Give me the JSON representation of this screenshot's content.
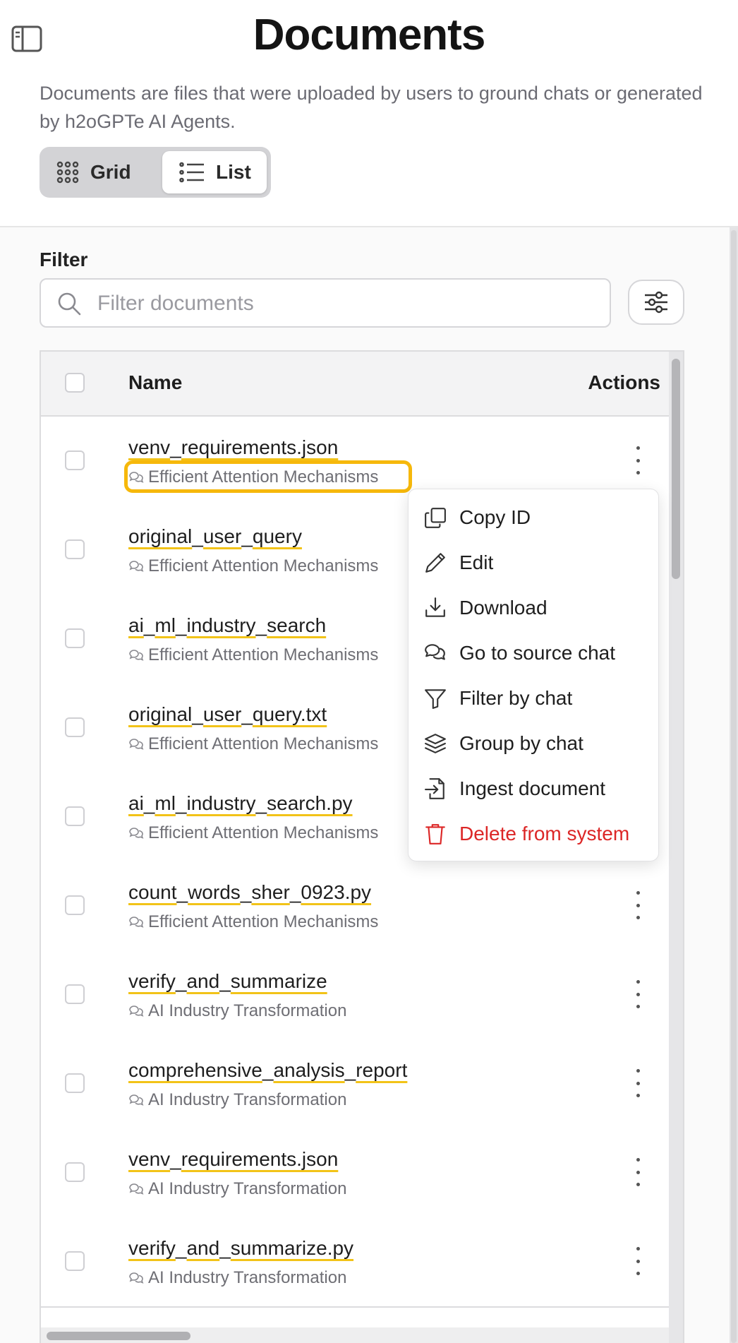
{
  "page": {
    "title": "Documents",
    "description": "Documents are files that were uploaded by users to ground chats or generated by h2oGPTe AI Agents."
  },
  "view_toggle": {
    "grid_label": "Grid",
    "list_label": "List",
    "selected": "List"
  },
  "filter": {
    "label": "Filter",
    "placeholder": "Filter documents",
    "value": ""
  },
  "table": {
    "columns": {
      "name": "Name",
      "actions": "Actions"
    },
    "rows": [
      {
        "name": "venv_requirements.json",
        "chat": "Efficient Attention Mechanisms"
      },
      {
        "name": "original_user_query",
        "chat": "Efficient Attention Mechanisms"
      },
      {
        "name": "ai_ml_industry_search",
        "chat": "Efficient Attention Mechanisms"
      },
      {
        "name": "original_user_query.txt",
        "chat": "Efficient Attention Mechanisms"
      },
      {
        "name": "ai_ml_industry_search.py",
        "chat": "Efficient Attention Mechanisms"
      },
      {
        "name": "count_words_sher_0923.py",
        "chat": "Efficient Attention Mechanisms"
      },
      {
        "name": "verify_and_summarize",
        "chat": "AI Industry Transformation"
      },
      {
        "name": "comprehensive_analysis_report",
        "chat": "AI Industry Transformation"
      },
      {
        "name": "venv_requirements.json",
        "chat": "AI Industry Transformation"
      },
      {
        "name": "verify_and_summarize.py",
        "chat": "AI Industry Transformation"
      }
    ]
  },
  "context_menu": {
    "items": [
      {
        "label": "Copy ID",
        "icon": "copy-icon"
      },
      {
        "label": "Edit",
        "icon": "pencil-icon"
      },
      {
        "label": "Download",
        "icon": "download-icon"
      },
      {
        "label": "Go to source chat",
        "icon": "chat-bubbles-icon"
      },
      {
        "label": "Filter by chat",
        "icon": "funnel-icon"
      },
      {
        "label": "Group by chat",
        "icon": "layers-icon"
      },
      {
        "label": "Ingest document",
        "icon": "ingest-icon"
      },
      {
        "label": "Delete from system",
        "icon": "trash-icon",
        "danger": true
      }
    ]
  },
  "colors": {
    "highlight": "#f6b80b",
    "danger": "#dc2626",
    "underline": "#f2c318"
  }
}
